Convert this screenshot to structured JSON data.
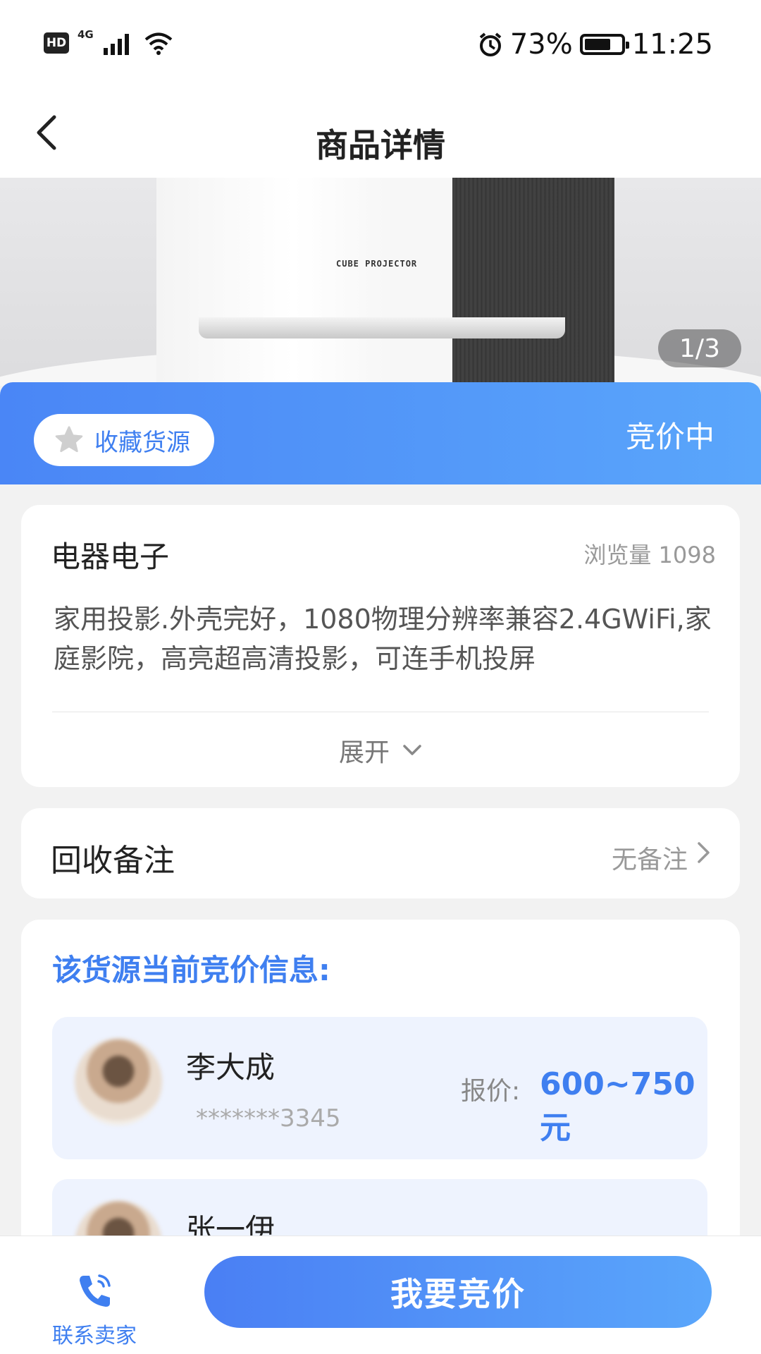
{
  "status_bar": {
    "hd": "HD",
    "network": "4G",
    "battery_percent": "73%",
    "battery_level": 0.73,
    "time": "11:25",
    "icons": [
      "hd-icon",
      "signal-icon",
      "wifi-icon",
      "alarm-icon",
      "battery-icon"
    ]
  },
  "header": {
    "title": "商品详情",
    "back_icon": "chevron-left-icon"
  },
  "gallery": {
    "product_text": "CUBE PROJECTOR",
    "pager": "1/3"
  },
  "band": {
    "favorite_label": "收藏货源",
    "favorite_icon": "star-icon",
    "status": "竞价中"
  },
  "product": {
    "category": "电器电子",
    "views": "浏览量 1098",
    "description": "家用投影.外壳完好，1080物理分辨率兼容2.4GWiFi,家庭影院，高亮超高清投影，可连手机投屏",
    "expand_label": "展开"
  },
  "remark": {
    "label": "回收备注",
    "value": "无备注"
  },
  "bids": {
    "title": "该货源当前竞价信息:",
    "items": [
      {
        "name": "李大成",
        "phone": "*******3345",
        "price_label": "报价:",
        "price": "600~750元"
      },
      {
        "name": "张一伊",
        "phone": "",
        "price_label": "",
        "price": ""
      }
    ]
  },
  "bottom": {
    "contact_label": "联系卖家",
    "contact_icon": "phone-icon",
    "bid_button": "我要竞价"
  },
  "colors": {
    "accent": "#3f7ff0",
    "band_start": "#4a86f6",
    "band_end": "#5aa6fb",
    "bid_row_bg": "#eef3fe"
  }
}
